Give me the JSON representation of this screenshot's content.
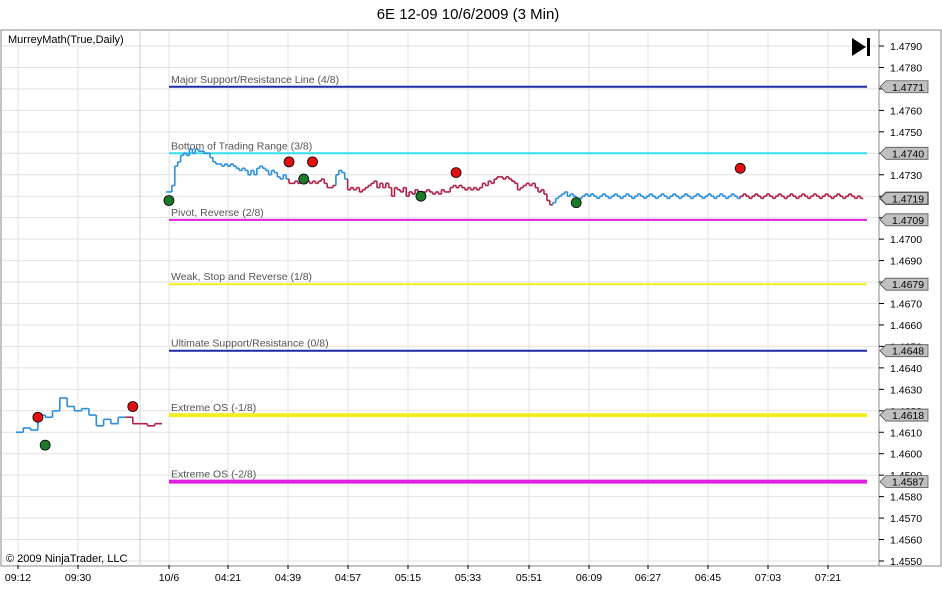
{
  "chart_data": {
    "type": "line",
    "title": "6E 12-09  10/6/2009 (3 Min)",
    "indicator": "MurreyMath(True,Daily)",
    "copyright": "© 2009 NinjaTrader, LLC",
    "ylim": [
      1.455,
      1.4795
    ],
    "y_ticks": [
      "1.4790",
      "1.4780",
      "1.4770",
      "1.4760",
      "1.4750",
      "1.4740",
      "1.4730",
      "1.4720",
      "1.4710",
      "1.4700",
      "1.4690",
      "1.4680",
      "1.4670",
      "1.4660",
      "1.4650",
      "1.4640",
      "1.4630",
      "1.4620",
      "1.4610",
      "1.4600",
      "1.4590",
      "1.4580",
      "1.4570",
      "1.4560",
      "1.4550"
    ],
    "x_ticks": [
      "09:12",
      "09:30",
      "10/6",
      "04:21",
      "04:39",
      "04:57",
      "05:15",
      "05:33",
      "05:51",
      "06:09",
      "06:27",
      "06:45",
      "07:03",
      "07:21"
    ],
    "levels": [
      {
        "label": "Major Support/Resistance Line (4/8)",
        "value": 1.4771,
        "tag": "1.4771",
        "color": "#1f2aa8",
        "width": 2
      },
      {
        "label": "Bottom of Trading Range (3/8)",
        "value": 1.474,
        "tag": "1.4740",
        "color": "#33e0f0",
        "width": 2
      },
      {
        "label": "Pivot, Reverse (2/8)",
        "value": 1.4709,
        "tag": "1.4709",
        "color": "#e020e0",
        "width": 2
      },
      {
        "label": "Weak, Stop and Reverse (1/8)",
        "value": 1.4679,
        "tag": "1.4679",
        "color": "#f0f020",
        "width": 2
      },
      {
        "label": "Ultimate Support/Resistance (0/8)",
        "value": 1.4648,
        "tag": "1.4648",
        "color": "#1f2aa8",
        "width": 2
      },
      {
        "label": "Extreme OS (-1/8)",
        "value": 1.4618,
        "tag": "1.4618",
        "color": "#f0f020",
        "width": 4
      },
      {
        "label": "Extreme OS (-2/8)",
        "value": 1.4587,
        "tag": "1.4587",
        "color": "#e020e0",
        "width": 4
      }
    ],
    "last_price": {
      "value": 1.4719,
      "tag": "1.4719"
    },
    "session_prior": {
      "x": [
        0,
        1,
        2,
        3,
        4,
        5,
        6,
        7,
        8,
        9,
        10,
        11,
        12,
        13,
        14,
        15,
        16,
        17,
        18,
        19
      ],
      "values": [
        1.461,
        1.4612,
        1.4611,
        1.4618,
        1.4617,
        1.462,
        1.4626,
        1.4622,
        1.462,
        1.4621,
        1.4618,
        1.4613,
        1.4616,
        1.4614,
        1.4617,
        1.4617,
        1.4614,
        1.4614,
        1.4613,
        1.4614
      ],
      "colors": [
        "up",
        "up",
        "up",
        "up",
        "up",
        "up",
        "up",
        "up",
        "up",
        "up",
        "up",
        "up",
        "up",
        "up",
        "up",
        "down",
        "down",
        "down",
        "down",
        "down"
      ]
    },
    "session_main": {
      "x": [
        0,
        1,
        2,
        3,
        4,
        5,
        6,
        7,
        8,
        9,
        10,
        11,
        12,
        13,
        14,
        15,
        16,
        17,
        18,
        19,
        20,
        21,
        22,
        23,
        24,
        25,
        26,
        27,
        28,
        29,
        30,
        31,
        32,
        33,
        34,
        35,
        36,
        37,
        38,
        39,
        40,
        41,
        42,
        43,
        44,
        45,
        46,
        47,
        48,
        49,
        50,
        51,
        52,
        53,
        54,
        55,
        56,
        57,
        58,
        59,
        60,
        61,
        62,
        63,
        64,
        65,
        66,
        67,
        68,
        69,
        70,
        71,
        72,
        73,
        74,
        75,
        76,
        77,
        78,
        79,
        80,
        81,
        82,
        83,
        84,
        85,
        86,
        87,
        88,
        89,
        90,
        91,
        92,
        93,
        94,
        95,
        96,
        97,
        98,
        99,
        100,
        101,
        102,
        103,
        104,
        105,
        106,
        107,
        108,
        109,
        110,
        111,
        112,
        113,
        114,
        115,
        116,
        117,
        118,
        119,
        120,
        121,
        122,
        123,
        124,
        125,
        126,
        127,
        128,
        129,
        130,
        131,
        132,
        133,
        134,
        135,
        136,
        137,
        138,
        139,
        140,
        141,
        142,
        143,
        144,
        145,
        146,
        147,
        148,
        149,
        150,
        151,
        152,
        153,
        154,
        155,
        156,
        157,
        158,
        159,
        160,
        161,
        162,
        163,
        164,
        165,
        166,
        167,
        168,
        169,
        170,
        171,
        172,
        173,
        174,
        175,
        176,
        177,
        178,
        179,
        180,
        181,
        182,
        183,
        184,
        185,
        186,
        187,
        188,
        189,
        190,
        191,
        192,
        193,
        194,
        195,
        196,
        197,
        198,
        199,
        200,
        201,
        202,
        203,
        204,
        205,
        206,
        207,
        208,
        209,
        210,
        211,
        212,
        213,
        214,
        215,
        216,
        217,
        218,
        219,
        220,
        221,
        222,
        223,
        224,
        225,
        226,
        227,
        228,
        229,
        230,
        231,
        232,
        233,
        234,
        235,
        236,
        237,
        238,
        239,
        240,
        241,
        242
      ],
      "values": [
        1.4722,
        1.4722,
        1.4725,
        1.4734,
        1.4736,
        1.4739,
        1.474,
        1.4739,
        1.4742,
        1.474,
        1.4742,
        1.4741,
        1.4741,
        1.474,
        1.474,
        1.4738,
        1.4736,
        1.4735,
        1.4735,
        1.4734,
        1.4735,
        1.4734,
        1.4735,
        1.4734,
        1.4733,
        1.4732,
        1.4733,
        1.4732,
        1.473,
        1.4732,
        1.473,
        1.4733,
        1.4734,
        1.4733,
        1.4732,
        1.473,
        1.4732,
        1.4731,
        1.4729,
        1.4728,
        1.473,
        1.4728,
        1.4726,
        1.4726,
        1.4727,
        1.4726,
        1.4727,
        1.4726,
        1.4727,
        1.4726,
        1.4727,
        1.4726,
        1.4727,
        1.4728,
        1.4726,
        1.4724,
        1.4724,
        1.4725,
        1.473,
        1.4732,
        1.4731,
        1.4728,
        1.4723,
        1.4724,
        1.4723,
        1.4724,
        1.4722,
        1.4723,
        1.4724,
        1.4725,
        1.4726,
        1.4727,
        1.4724,
        1.4726,
        1.4724,
        1.4726,
        1.4724,
        1.472,
        1.4724,
        1.4723,
        1.4722,
        1.4724,
        1.472,
        1.4722,
        1.4721,
        1.4723,
        1.4722,
        1.4721,
        1.4722,
        1.4723,
        1.4722,
        1.4721,
        1.4722,
        1.4721,
        1.4723,
        1.4722,
        1.4722,
        1.4724,
        1.4725,
        1.4724,
        1.4725,
        1.4724,
        1.4723,
        1.4724,
        1.4723,
        1.4724,
        1.4723,
        1.4724,
        1.4726,
        1.4725,
        1.4727,
        1.4726,
        1.4728,
        1.4729,
        1.4729,
        1.4728,
        1.4729,
        1.4728,
        1.4727,
        1.4726,
        1.4723,
        1.4724,
        1.4725,
        1.4726,
        1.4725,
        1.4726,
        1.4724,
        1.4722,
        1.4723,
        1.4721,
        1.4718,
        1.4716,
        1.4717,
        1.4719,
        1.472,
        1.4721,
        1.4722,
        1.472,
        1.4721,
        1.472,
        1.4719,
        1.4719,
        1.472,
        1.4721,
        1.472,
        1.4721,
        1.472,
        1.4719,
        1.472,
        1.4721,
        1.472,
        1.4719,
        1.472,
        1.4721,
        1.472,
        1.4719,
        1.472,
        1.4721,
        1.472,
        1.4719,
        1.472,
        1.4721,
        1.472,
        1.4719,
        1.472,
        1.4721,
        1.472,
        1.4719,
        1.472,
        1.4721,
        1.472,
        1.4719,
        1.472,
        1.4721,
        1.472,
        1.4719,
        1.472,
        1.4721,
        1.472,
        1.4719,
        1.472,
        1.4721,
        1.472,
        1.4719,
        1.472,
        1.4721,
        1.472,
        1.4719,
        1.472,
        1.4721,
        1.472,
        1.4719,
        1.472,
        1.4721,
        1.472,
        1.4719,
        1.472,
        1.4721,
        1.472,
        1.4719,
        1.472,
        1.4721,
        1.472,
        1.4719,
        1.472,
        1.4721,
        1.472,
        1.4719,
        1.472,
        1.4721,
        1.472,
        1.4719,
        1.472,
        1.4721,
        1.472,
        1.4719,
        1.472,
        1.4721,
        1.472,
        1.4719,
        1.472,
        1.4721,
        1.472,
        1.4719,
        1.472,
        1.4721,
        1.472,
        1.4719,
        1.472,
        1.4721,
        1.472,
        1.4719,
        1.472,
        1.4721,
        1.472,
        1.4719,
        1.472,
        1.4719
      ],
      "colors": "up-until-16-then-mixed"
    },
    "markers": [
      {
        "session": "prior",
        "x": 3,
        "value": 1.4617,
        "kind": "sell"
      },
      {
        "session": "prior",
        "x": 4,
        "value": 1.4604,
        "kind": "buy"
      },
      {
        "session": "prior",
        "x": 16,
        "value": 1.4622,
        "kind": "sell"
      },
      {
        "session": "main",
        "x": 1,
        "value": 1.4718,
        "kind": "buy"
      },
      {
        "session": "main",
        "x": 42,
        "value": 1.4736,
        "kind": "sell"
      },
      {
        "session": "main",
        "x": 47,
        "value": 1.4728,
        "kind": "buy"
      },
      {
        "session": "main",
        "x": 50,
        "value": 1.4736,
        "kind": "sell"
      },
      {
        "session": "main",
        "x": 87,
        "value": 1.472,
        "kind": "buy"
      },
      {
        "session": "main",
        "x": 99,
        "value": 1.4731,
        "kind": "sell"
      },
      {
        "session": "main",
        "x": 140,
        "value": 1.4717,
        "kind": "buy"
      },
      {
        "session": "main",
        "x": 196,
        "value": 1.4733,
        "kind": "sell"
      }
    ],
    "colors": {
      "up": "#2b8fe0",
      "down": "#b0204a",
      "sell_marker": "#e01010",
      "buy_marker": "#1a7a2a",
      "grid": "#e2e2e2",
      "tag_fill": "#c0c0c0"
    },
    "grid": true
  }
}
